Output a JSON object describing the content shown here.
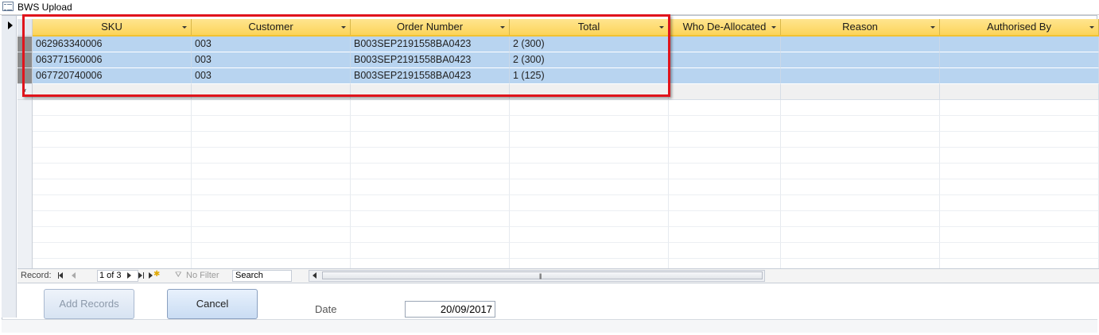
{
  "window": {
    "title": "BWS Upload"
  },
  "columns": [
    {
      "label": "SKU",
      "filter": true
    },
    {
      "label": "Customer",
      "filter": true
    },
    {
      "label": "Order Number",
      "filter": true
    },
    {
      "label": "Total",
      "filter": true
    },
    {
      "label": "Who De-Allocated",
      "filter": true
    },
    {
      "label": "Reason",
      "filter": true
    },
    {
      "label": "Authorised By",
      "filter": true
    }
  ],
  "rows": [
    [
      "062963340006",
      "003",
      "B003SEP2191558BA0423",
      "2 (300)",
      "",
      "",
      ""
    ],
    [
      "063771560006",
      "003",
      "B003SEP2191558BA0423",
      "2 (300)",
      "",
      "",
      ""
    ],
    [
      "067720740006",
      "003",
      "B003SEP2191558BA0423",
      "1 (125)",
      "",
      "",
      ""
    ]
  ],
  "new_row_marker": "*",
  "navigation": {
    "record_label": "Record:",
    "position": "1 of 3",
    "filter_label": "No Filter",
    "search_value": "Search"
  },
  "form": {
    "add_records_label": "Add Records",
    "cancel_label": "Cancel",
    "date_label": "Date",
    "date_value": "20/09/2017"
  },
  "colors": {
    "header": "#fed966",
    "selected_row": "#b8d4f0",
    "highlight_box": "#e0141c"
  }
}
